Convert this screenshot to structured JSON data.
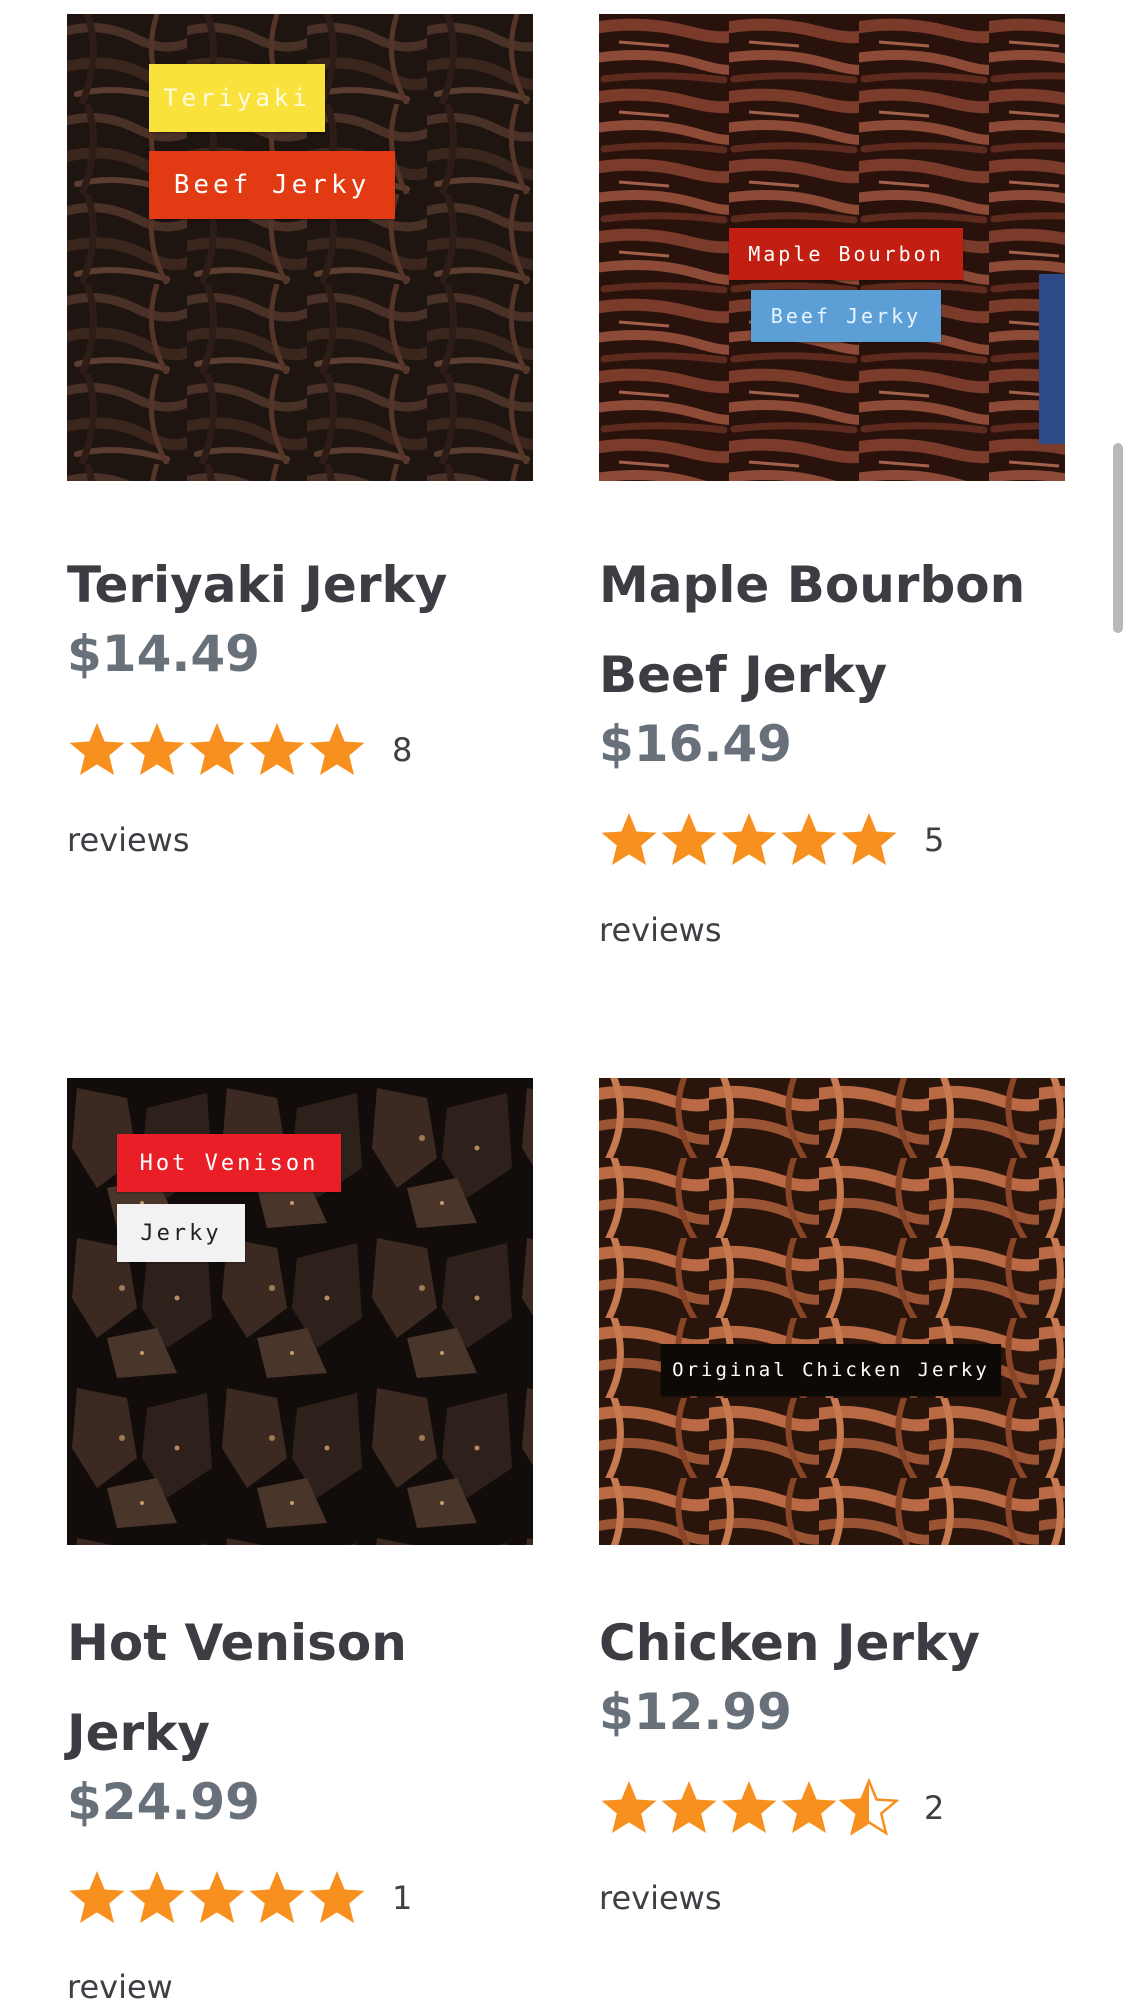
{
  "colors": {
    "star": "#f7901e",
    "title": "#3b3d42",
    "price": "#687079"
  },
  "products": [
    {
      "title": "Teriyaki Jerky",
      "price": "$14.49",
      "rating": 5,
      "review_count": "8",
      "review_word": "reviews",
      "image_labels": [
        "Teriyaki",
        "Beef Jerky"
      ]
    },
    {
      "title": "Maple Bourbon Beef Jerky",
      "price": "$16.49",
      "rating": 5,
      "review_count": "5",
      "review_word": "reviews",
      "image_labels": [
        "Maple Bourbon",
        "Beef Jerky"
      ]
    },
    {
      "title": "Hot Venison Jerky",
      "price": "$24.99",
      "rating": 5,
      "review_count": "1",
      "review_word": "review",
      "image_labels": [
        "Hot Venison",
        "Jerky"
      ]
    },
    {
      "title": "Chicken Jerky",
      "price": "$12.99",
      "rating": 4.5,
      "review_count": "2",
      "review_word": "reviews",
      "image_labels": [
        "Original Chicken Jerky"
      ]
    }
  ]
}
